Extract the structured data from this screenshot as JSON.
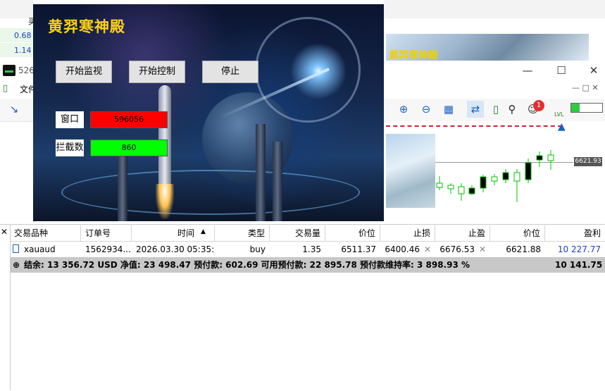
{
  "overlay": {
    "title": "黄羿寒神殿",
    "buttons": {
      "monitor": "开始监视",
      "control": "开始控制",
      "stop": "停止"
    },
    "window_label": "窗口",
    "window_value": "596056",
    "intercept_label": "拦截数",
    "intercept_value": "860",
    "colors": {
      "window_field": "#ff0000",
      "intercept_field": "#00ff00",
      "title": "#ffd21a"
    }
  },
  "terminal": {
    "left_values": [
      "0.68",
      "1.14"
    ],
    "left_partial": "买",
    "title_partial": "526",
    "menu_partial": "文件",
    "banner_text": "黄羿寒神殿",
    "price_tag": "6621.93",
    "notification_count": "1",
    "lvl_label": "LVL"
  },
  "table": {
    "headers": [
      "交易品种",
      "订单号",
      "时间",
      "类型",
      "交易量",
      "价位",
      "止损",
      "止盈",
      "价位",
      "盈利"
    ],
    "sort_indicator": "▲",
    "row": {
      "symbol": "xauaud",
      "order": "1562934...",
      "time": "2026.03.30 05:35:...",
      "type": "buy",
      "volume": "1.35",
      "open_price": "6511.37",
      "stop_loss": "6400.46",
      "take_profit": "6676.53",
      "current_price": "6621.88",
      "profit": "10 227.77"
    },
    "summary": {
      "text": "结余: 13 356.72 USD  净值: 23 498.47  预付款: 602.69  可用预付款: 22 895.78  预付款维持率: 3 898.93 %",
      "total": "10 141.75"
    }
  }
}
